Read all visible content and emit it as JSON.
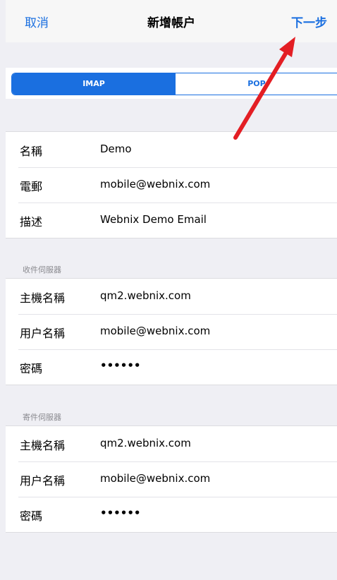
{
  "navbar": {
    "cancel": "取消",
    "title": "新增帳户",
    "next": "下一步"
  },
  "segmented": {
    "imap": "IMAP",
    "pop": "POP"
  },
  "account": {
    "name_label": "名稱",
    "name_value": "Demo",
    "email_label": "電郵",
    "email_value": "mobile@webnix.com",
    "desc_label": "描述",
    "desc_value": "Webnix Demo Email"
  },
  "incoming": {
    "header": "收件伺服器",
    "host_label": "主機名稱",
    "host_value": "qm2.webnix.com",
    "user_label": "用户名稱",
    "user_value": "mobile@webnix.com",
    "password_label": "密碼",
    "password_value": "••••••"
  },
  "outgoing": {
    "header": "寄件伺服器",
    "host_label": "主機名稱",
    "host_value": "qm2.webnix.com",
    "user_label": "用户名稱",
    "user_value": "mobile@webnix.com",
    "password_label": "密碼",
    "password_value": "••••••"
  },
  "colors": {
    "accent": "#1a6fe0",
    "arrow": "#e31e24",
    "background": "#efeff4"
  }
}
